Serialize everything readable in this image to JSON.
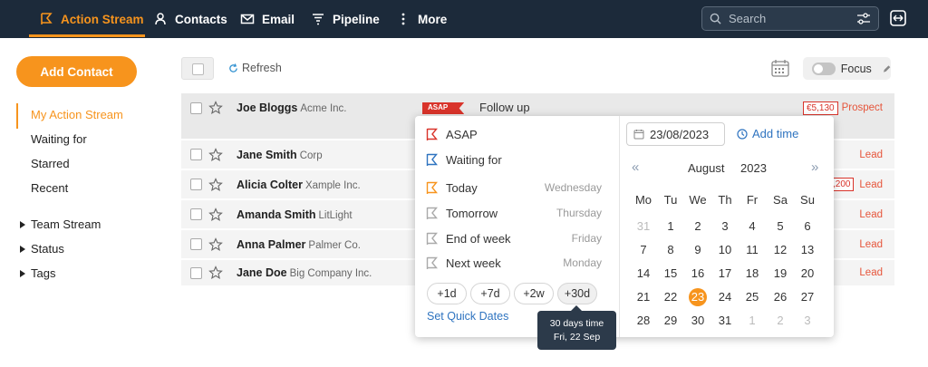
{
  "nav": {
    "items": [
      {
        "label": "Action Stream",
        "icon": "flag-icon",
        "active": true
      },
      {
        "label": "Contacts",
        "icon": "person-icon"
      },
      {
        "label": "Email",
        "icon": "envelope-icon"
      },
      {
        "label": "Pipeline",
        "icon": "funnel-icon"
      },
      {
        "label": "More",
        "icon": "more-vertical-icon"
      }
    ],
    "search_placeholder": "Search"
  },
  "sidebar": {
    "add_contact": "Add Contact",
    "items": [
      "My Action Stream",
      "Waiting for",
      "Starred",
      "Recent"
    ],
    "groups": [
      "Team Stream",
      "Status",
      "Tags"
    ]
  },
  "toolbar": {
    "refresh": "Refresh",
    "focus": "Focus"
  },
  "rows": [
    {
      "name": "Joe Bloggs",
      "company": "Acme Inc.",
      "tag": "ASAP",
      "task": "Follow up",
      "amount": "€5,130",
      "status": "Prospect"
    },
    {
      "name": "Jane Smith",
      "company": "Corp",
      "status": "Lead"
    },
    {
      "name": "Alicia Colter",
      "company": "Xample Inc.",
      "amount": ",200",
      "status": "Lead"
    },
    {
      "name": "Amanda Smith",
      "company": "LitLight",
      "status": "Lead"
    },
    {
      "name": "Anna Palmer",
      "company": "Palmer Co.",
      "status": "Lead"
    },
    {
      "name": "Jane Doe",
      "company": "Big Company Inc.",
      "status": "Lead"
    }
  ],
  "popup": {
    "options": [
      {
        "label": "ASAP",
        "day": "",
        "color": "#d9342b"
      },
      {
        "label": "Waiting for",
        "day": "",
        "color": "#2f74c0"
      },
      {
        "label": "Today",
        "day": "Wednesday",
        "color": "#f7941d"
      },
      {
        "label": "Tomorrow",
        "day": "Thursday",
        "color": "#aaaaaa"
      },
      {
        "label": "End of week",
        "day": "Friday",
        "color": "#aaaaaa"
      },
      {
        "label": "Next week",
        "day": "Monday",
        "color": "#aaaaaa"
      }
    ],
    "quick_dates": [
      "+1d",
      "+7d",
      "+2w",
      "+30d"
    ],
    "set_quick_dates": "Set Quick Dates",
    "tooltip_line1": "30 days time",
    "tooltip_line2": "Fri, 22 Sep",
    "date_value": "23/08/2023",
    "add_time": "Add time",
    "month": "August",
    "year": "2023",
    "prev": "«",
    "next": "»",
    "weekdays": [
      "Mo",
      "Tu",
      "We",
      "Th",
      "Fr",
      "Sa",
      "Su"
    ],
    "weeks": [
      [
        "31",
        "1",
        "2",
        "3",
        "4",
        "5",
        "6"
      ],
      [
        "7",
        "8",
        "9",
        "10",
        "11",
        "12",
        "13"
      ],
      [
        "14",
        "15",
        "16",
        "17",
        "18",
        "19",
        "20"
      ],
      [
        "21",
        "22",
        "23",
        "24",
        "25",
        "26",
        "27"
      ],
      [
        "28",
        "29",
        "30",
        "31",
        "1",
        "2",
        "3"
      ]
    ],
    "selected": "23"
  }
}
